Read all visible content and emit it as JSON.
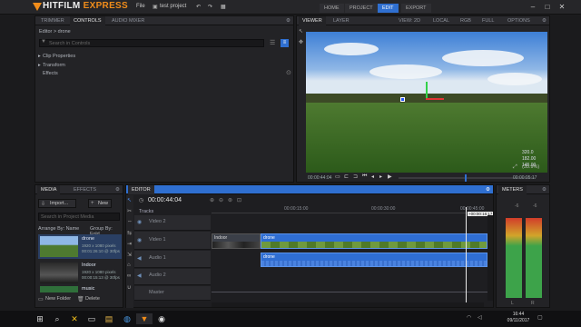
{
  "app": {
    "logo_main": "HITFILM",
    "logo_sub": "EXPRESS",
    "menu_file": "File",
    "project_name": "test project",
    "nav": [
      "HOME",
      "PROJECT",
      "EDIT",
      "EXPORT"
    ]
  },
  "controls_panel": {
    "tabs": [
      "TRIMMER",
      "CONTROLS",
      "AUDIO MIXER"
    ],
    "breadcrumb": "Editor > drone",
    "search_placeholder": "Search in Controls",
    "sections": [
      "Clip Properties",
      "Transform",
      "Effects"
    ]
  },
  "viewer_panel": {
    "tabs": [
      "VIEWER",
      "LAYER"
    ],
    "view_option": "VIEW: 2D",
    "space_option": "LOCAL",
    "color_option": "RGB",
    "size_option": "FULL",
    "options_label": "OPTIONS",
    "timecode_start": "00:00:44:04",
    "timecode_end": "00:00:05:17",
    "zoom": "(35.9%)",
    "overlay_1": "320.0",
    "overlay_2": "182.00",
    "overlay_3": "145.00"
  },
  "media_panel": {
    "tabs": [
      "MEDIA",
      "EFFECTS"
    ],
    "import_label": "Import...",
    "new_label": "New",
    "search_placeholder": "Search in Project Media",
    "arrange_label": "Arrange By: Name",
    "group_label": "Group By: Fold",
    "items": [
      {
        "name": "drone",
        "info": "1920 x 1080 pixels",
        "meta": "00:01:26:10 @ 30fps"
      },
      {
        "name": "Indoor",
        "info": "1920 x 1080 pixels",
        "meta": "00:00:15:13 @ 30fps"
      },
      {
        "name": "music",
        "info": "",
        "meta": ""
      }
    ],
    "new_folder_label": "New Folder",
    "delete_label": "Delete"
  },
  "editor_panel": {
    "title": "EDITOR",
    "timecode": "00:00:44:04",
    "tracks_label": "Tracks",
    "ruler_marks": [
      "00:00:15:00",
      "00:00:30:00",
      "00:00:45:00"
    ],
    "playhead_tooltip": "+00:00:16:17",
    "tracks": [
      {
        "name": "Video 2"
      },
      {
        "name": "Video 1"
      },
      {
        "name": "Audio 1"
      },
      {
        "name": "Audio 2"
      },
      {
        "name": "Master"
      }
    ],
    "clip_indoor": "Indoor",
    "clip_drone_video": "drone",
    "clip_drone_audio": "drone"
  },
  "meters_panel": {
    "title": "METERS",
    "left_label": "L",
    "right_label": "R",
    "top_left": "-6",
    "top_right": "-6"
  },
  "taskbar": {
    "time": "16:44",
    "date": "09/11/2017"
  }
}
